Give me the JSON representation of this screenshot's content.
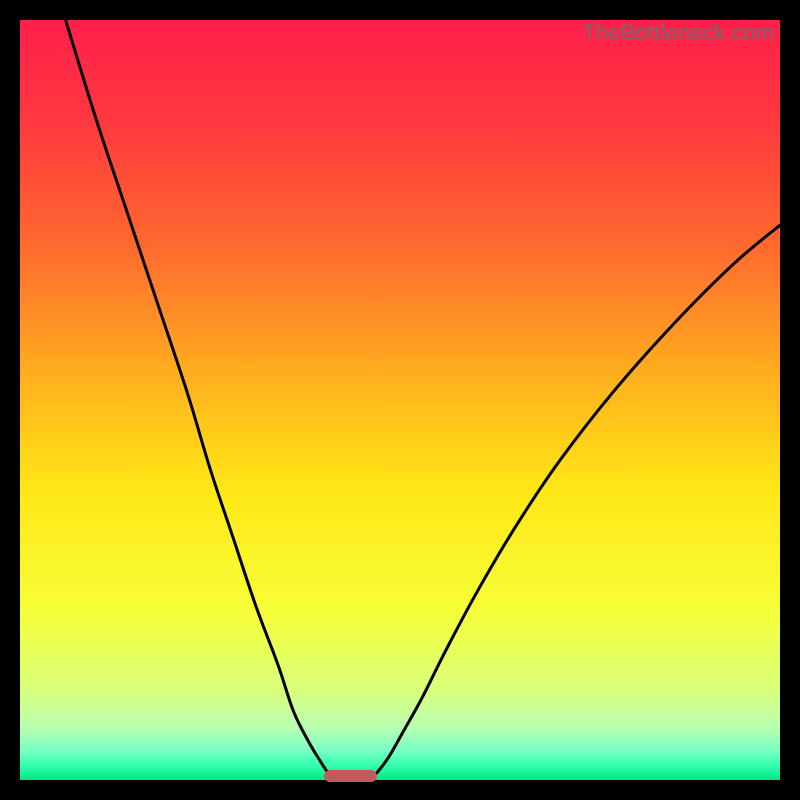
{
  "watermark": {
    "text": "TheBottleneck.com"
  },
  "colors": {
    "frame": "#000000",
    "curve": "#000000",
    "marker": "#c35a5a",
    "gradient_stops": [
      {
        "pct": 0,
        "color": "#ff1f4b"
      },
      {
        "pct": 14,
        "color": "#ff3a3f"
      },
      {
        "pct": 30,
        "color": "#ff6a2e"
      },
      {
        "pct": 48,
        "color": "#ffb41d"
      },
      {
        "pct": 62,
        "color": "#ffe716"
      },
      {
        "pct": 78,
        "color": "#f6ff3a"
      },
      {
        "pct": 88,
        "color": "#d9ff7a"
      },
      {
        "pct": 93,
        "color": "#b9ffb0"
      },
      {
        "pct": 96,
        "color": "#7dffc4"
      },
      {
        "pct": 98,
        "color": "#35ffb0"
      },
      {
        "pct": 100,
        "color": "#00e884"
      }
    ]
  },
  "chart_data": {
    "type": "line",
    "title": "",
    "xlabel": "",
    "ylabel": "",
    "xlim": [
      0,
      100
    ],
    "ylim": [
      0,
      100
    ],
    "grid": false,
    "legend": false,
    "series": [
      {
        "name": "left-branch",
        "x": [
          6,
          10,
          14,
          18,
          22,
          25,
          28,
          31,
          34,
          36,
          38,
          39.5,
          40.5,
          41.5
        ],
        "values": [
          100,
          87,
          75,
          63,
          51,
          41,
          32,
          23,
          15,
          9,
          5,
          2.5,
          1,
          0
        ]
      },
      {
        "name": "right-branch",
        "x": [
          46,
          47,
          48.5,
          50.5,
          53,
          56,
          60,
          65,
          71,
          78,
          86,
          94,
          100
        ],
        "values": [
          0,
          1,
          3,
          6.5,
          11,
          17,
          24.5,
          33,
          42,
          51,
          60,
          68,
          73
        ]
      }
    ],
    "optimal_marker": {
      "x_start": 40,
      "x_end": 47,
      "y": 0
    }
  }
}
